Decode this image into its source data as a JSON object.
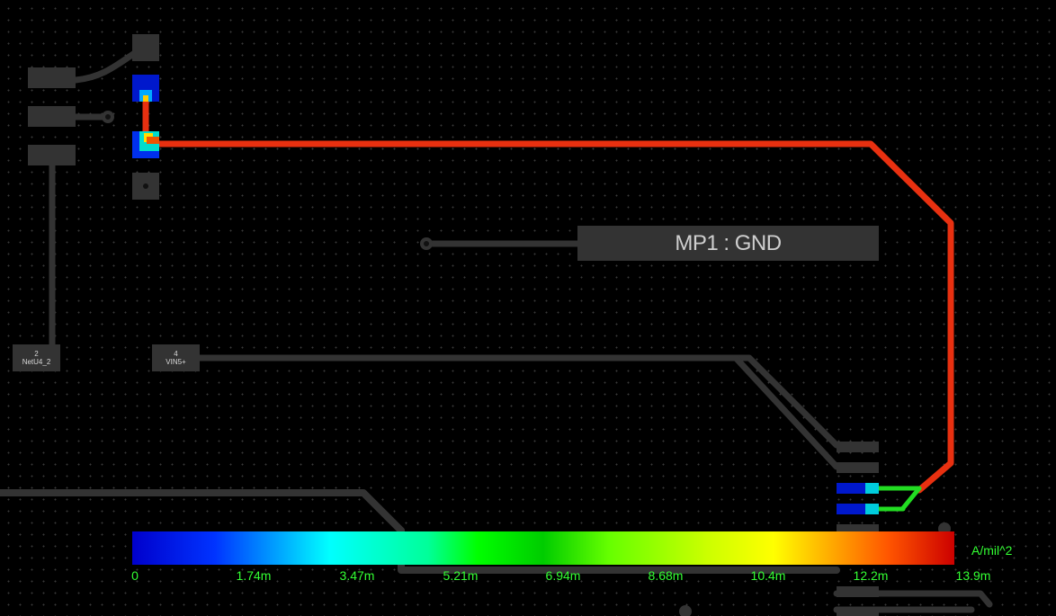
{
  "colors": {
    "background": "#000000",
    "copper": "#333333",
    "trace_high": "#e83010",
    "trace_mid": "#22dd22",
    "legend_text": "#33ff33"
  },
  "components": {
    "net_pad_2": {
      "pin": "2",
      "net": "NetU4_2"
    },
    "vin_pad_4": {
      "pin": "4",
      "net": "VIN5+"
    }
  },
  "mounting_pad": {
    "label": "MP1 : GND"
  },
  "legend": {
    "unit": "A/mil^2",
    "ticks": [
      "0",
      "1.74m",
      "3.47m",
      "5.21m",
      "6.94m",
      "8.68m",
      "10.4m",
      "12.2m",
      "13.9m"
    ],
    "min": 0,
    "max": 0.0139
  }
}
